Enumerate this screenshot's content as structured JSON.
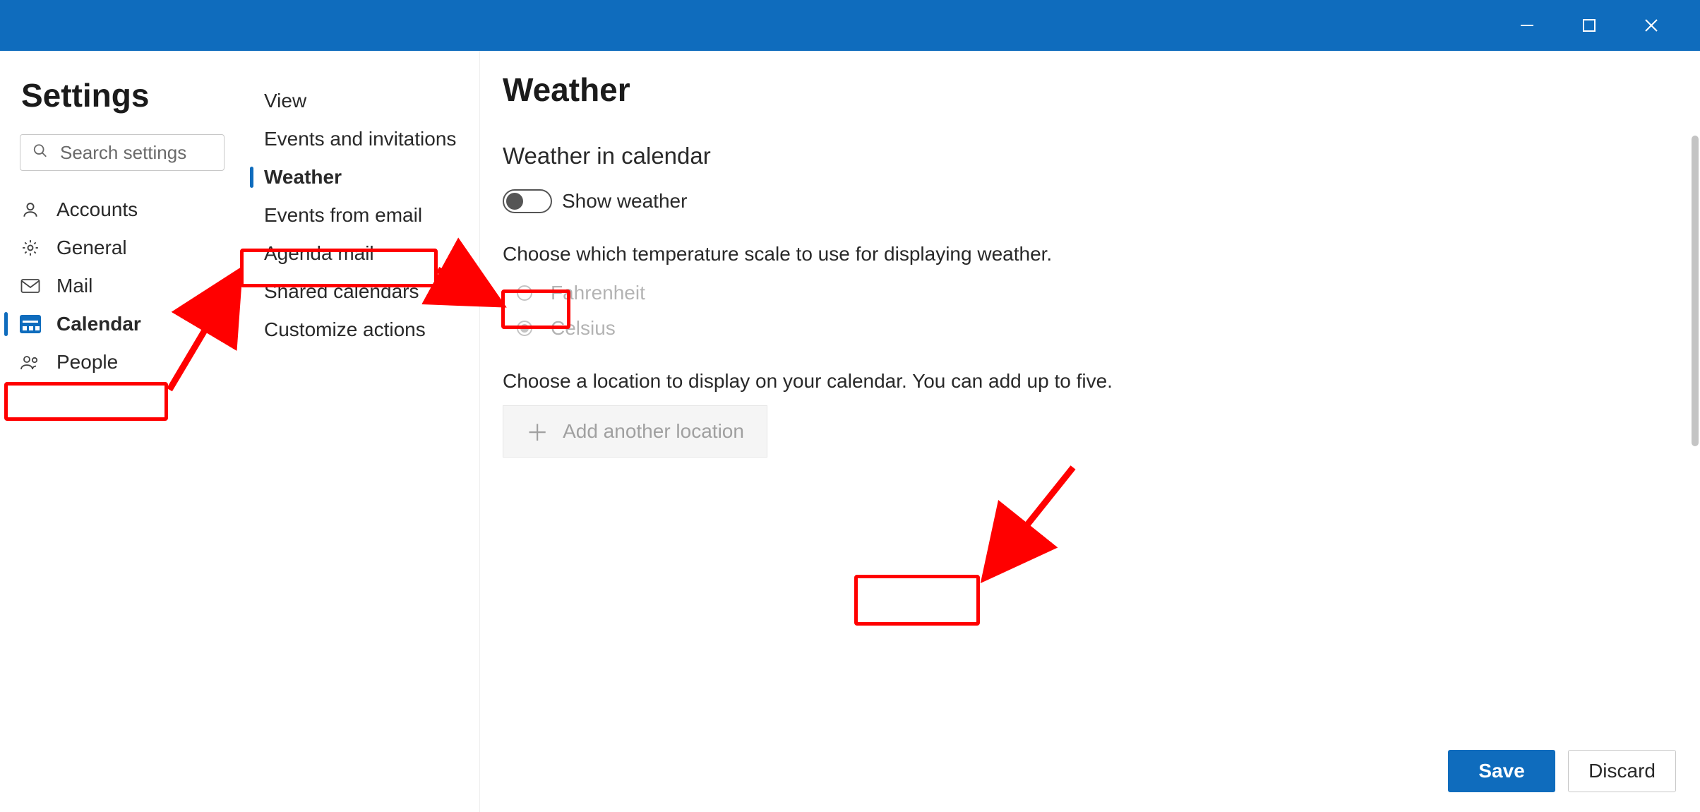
{
  "window": {
    "minimize_icon": "minimize",
    "maximize_icon": "maximize",
    "close_icon": "close"
  },
  "sidebar": {
    "title": "Settings",
    "search_placeholder": "Search settings",
    "items": [
      {
        "label": "Accounts",
        "icon": "person"
      },
      {
        "label": "General",
        "icon": "gear"
      },
      {
        "label": "Mail",
        "icon": "mail"
      },
      {
        "label": "Calendar",
        "icon": "calendar",
        "selected": true
      },
      {
        "label": "People",
        "icon": "people"
      }
    ]
  },
  "midnav": {
    "items": [
      {
        "label": "View"
      },
      {
        "label": "Events and invitations"
      },
      {
        "label": "Weather",
        "selected": true
      },
      {
        "label": "Events from email"
      },
      {
        "label": "Agenda mail"
      },
      {
        "label": "Shared calendars"
      },
      {
        "label": "Customize actions"
      }
    ]
  },
  "content": {
    "title": "Weather",
    "section_title": "Weather in calendar",
    "toggle_label": "Show weather",
    "toggle_state": "off",
    "scale_desc": "Choose which temperature scale to use for displaying weather.",
    "radio_options": [
      {
        "label": "Fahrenheit",
        "checked": false
      },
      {
        "label": "Celsius",
        "checked": true
      }
    ],
    "location_desc": "Choose a location to display on your calendar. You can add up to five.",
    "add_location_label": "Add another location"
  },
  "footer": {
    "save_label": "Save",
    "discard_label": "Discard"
  },
  "colors": {
    "accent": "#0f6cbd",
    "annotation": "#ff0000"
  }
}
